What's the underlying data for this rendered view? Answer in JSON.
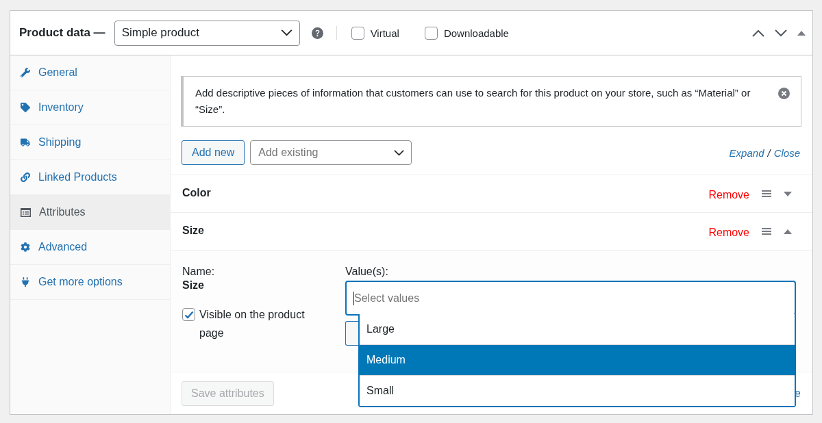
{
  "header": {
    "title": "Product data —",
    "product_type": {
      "value": "Simple product"
    },
    "options": [
      {
        "label": "Virtual",
        "checked": false
      },
      {
        "label": "Downloadable",
        "checked": false
      }
    ]
  },
  "sidebar": {
    "items": [
      {
        "label": "General",
        "selected": false
      },
      {
        "label": "Inventory",
        "selected": false
      },
      {
        "label": "Shipping",
        "selected": false
      },
      {
        "label": "Linked Products",
        "selected": false
      },
      {
        "label": "Attributes",
        "selected": true
      },
      {
        "label": "Advanced",
        "selected": false
      },
      {
        "label": "Get more options",
        "selected": false
      }
    ]
  },
  "notice": {
    "text": "Add descriptive pieces of information that customers can use to search for this product on your store, such as “Material” or “Size”."
  },
  "toolbar": {
    "add_button": "Add new",
    "existing_field": {
      "placeholder": "Add existing"
    },
    "expand_link": "Expand",
    "separator": "/",
    "close_link": "Close"
  },
  "attributes": [
    {
      "name": "Color",
      "remove_link": "Remove",
      "expanded": false
    },
    {
      "name": "Size",
      "remove_link": "Remove",
      "expanded": true,
      "name_label": "Name:",
      "name_value": "Size",
      "visible_option": {
        "label": "Visible on the product page",
        "checked": true
      },
      "values_label": "Value(s):",
      "values_field": {
        "placeholder": "Select values"
      },
      "value_options": [
        {
          "label": "Large",
          "selected": false
        },
        {
          "label": "Medium",
          "selected": true
        },
        {
          "label": "Small",
          "selected": false
        }
      ]
    }
  ],
  "footer": {
    "save_button": {
      "label": "Save attributes",
      "disabled": true
    },
    "right_text": "e"
  }
}
